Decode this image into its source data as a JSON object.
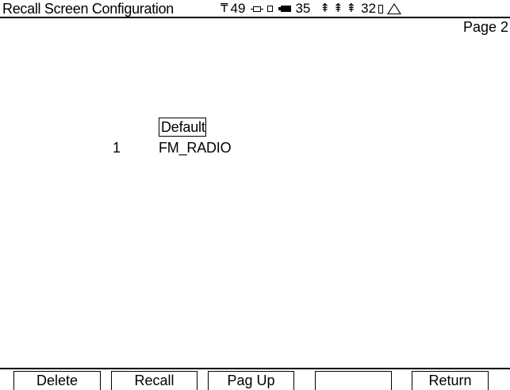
{
  "header": {
    "title": "Recall Screen Configuration",
    "signal_value": "49",
    "battery_value": "35",
    "temp_value": "32",
    "icons": [
      "antenna-icon",
      "plug-icon",
      "small-square-icon",
      "battery-icon",
      "triple-arrow-icon",
      "rectangle-icon",
      "warning-icon"
    ]
  },
  "page_label": "Page 2",
  "list": {
    "items": [
      {
        "number": "",
        "name": "Default",
        "selected": true
      },
      {
        "number": "1",
        "name": "FM_RADIO",
        "selected": false
      }
    ]
  },
  "softkeys": [
    {
      "label": "Delete"
    },
    {
      "label": "Recall"
    },
    {
      "label": "Pag Up"
    },
    {
      "label": ""
    },
    {
      "label": "Return"
    }
  ]
}
